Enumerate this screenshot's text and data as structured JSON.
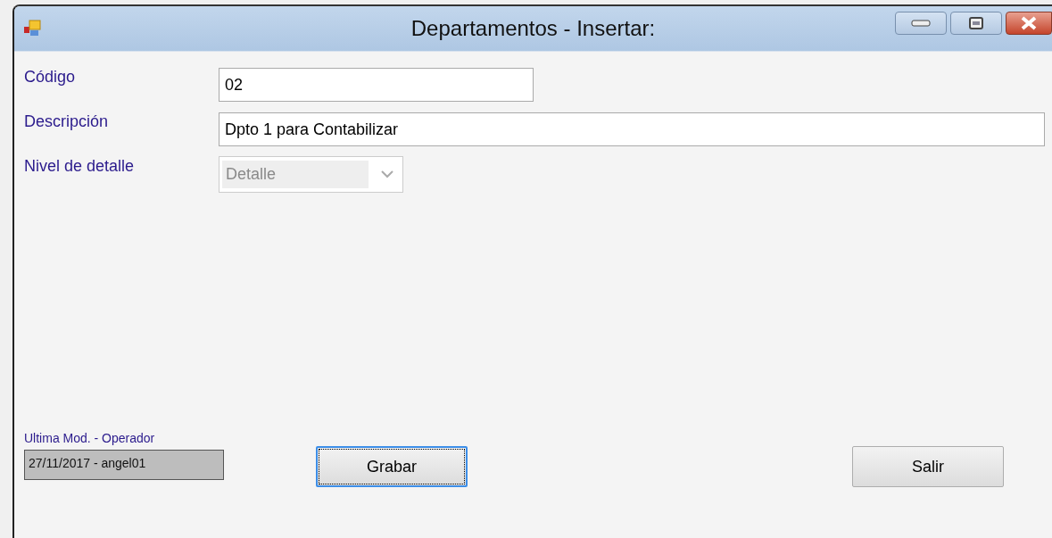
{
  "window": {
    "title": "Departamentos - Insertar:"
  },
  "fields": [
    {
      "label": "Código",
      "kind": "text",
      "value": "02",
      "disabled": false,
      "wide": false
    },
    {
      "label": "Descripción",
      "kind": "text",
      "value": "Dpto 1 para Contabilizar",
      "disabled": false,
      "wide": true
    },
    {
      "label": "Nivel de detalle",
      "kind": "select",
      "value": "Detalle",
      "disabled": true,
      "wide": false
    }
  ],
  "last_modified": {
    "label": "Ultima Mod. - Operador",
    "value": "27/11/2017 - angel01"
  },
  "buttons": [
    {
      "label": "Grabar",
      "focused": true
    },
    {
      "label": "Salir",
      "focused": false
    }
  ]
}
